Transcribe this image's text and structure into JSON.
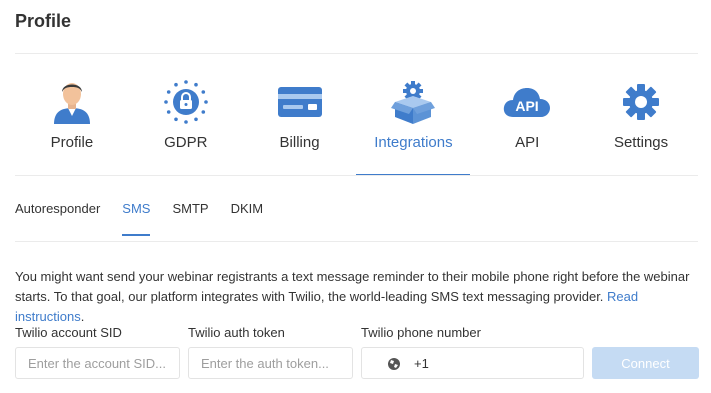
{
  "page": {
    "title": "Profile"
  },
  "tabs": [
    {
      "label": "Profile",
      "icon": "user-avatar-icon",
      "active": false
    },
    {
      "label": "GDPR",
      "icon": "gdpr-lock-icon",
      "active": false
    },
    {
      "label": "Billing",
      "icon": "credit-card-icon",
      "active": false
    },
    {
      "label": "Integrations",
      "icon": "box-gear-icon",
      "active": true
    },
    {
      "label": "API",
      "icon": "api-cloud-icon",
      "active": false
    },
    {
      "label": "Settings",
      "icon": "gear-icon",
      "active": false
    }
  ],
  "subtabs": [
    {
      "label": "Autoresponder",
      "active": false
    },
    {
      "label": "SMS",
      "active": true
    },
    {
      "label": "SMTP",
      "active": false
    },
    {
      "label": "DKIM",
      "active": false
    }
  ],
  "description": {
    "text": "You might want send your webinar registrants a text message reminder to their mobile phone right before the webinar starts. To that goal, our platform integrates with Twilio, the world-leading SMS text messaging provider.",
    "link_text": "Read instructions",
    "trailing": "."
  },
  "form": {
    "sid_label": "Twilio account SID",
    "sid_placeholder": "Enter the account SID...",
    "token_label": "Twilio auth token",
    "token_placeholder": "Enter the auth token...",
    "phone_label": "Twilio phone number",
    "phone_country_icon": "us-flag-icon",
    "phone_dial_code": "+1",
    "connect_label": "Connect"
  },
  "colors": {
    "accent": "#3f7ccb",
    "button_disabled": "#c5dbf3",
    "divider": "#ebebeb"
  }
}
